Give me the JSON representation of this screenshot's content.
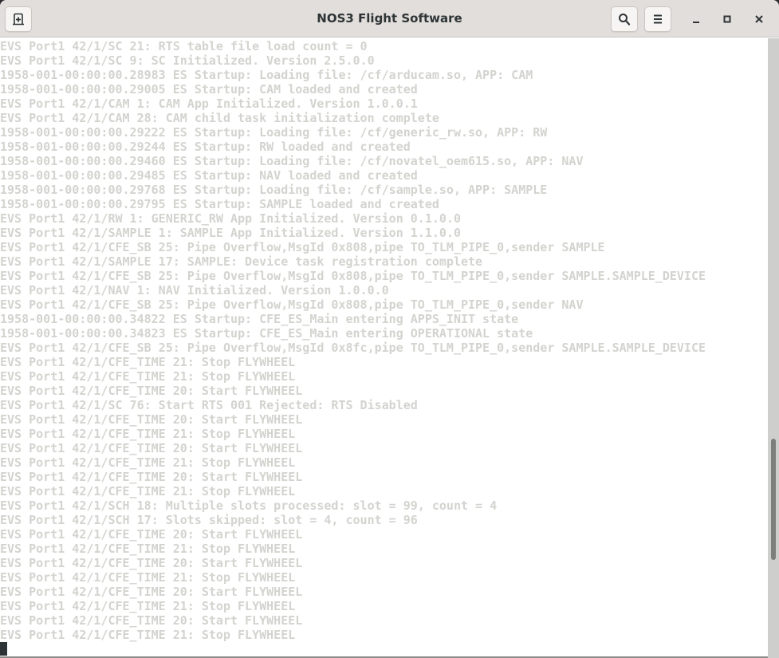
{
  "window": {
    "title": "NOS3 Flight Software"
  },
  "header": {
    "new_tab_icon": "new-tab-icon",
    "search_icon": "search-icon",
    "menu_icon": "hamburger-menu-icon",
    "minimize_icon": "minimize-icon",
    "maximize_icon": "maximize-icon",
    "close_icon": "close-icon"
  },
  "terminal": {
    "lines": [
      "EVS Port1 42/1/SC 21: RTS table file load count = 0",
      "EVS Port1 42/1/SC 9: SC Initialized. Version 2.5.0.0",
      "1958-001-00:00:00.28983 ES Startup: Loading file: /cf/arducam.so, APP: CAM",
      "1958-001-00:00:00.29005 ES Startup: CAM loaded and created",
      "EVS Port1 42/1/CAM 1: CAM App Initialized. Version 1.0.0.1",
      "EVS Port1 42/1/CAM 28: CAM child task initialization complete",
      "1958-001-00:00:00.29222 ES Startup: Loading file: /cf/generic_rw.so, APP: RW",
      "1958-001-00:00:00.29244 ES Startup: RW loaded and created",
      "1958-001-00:00:00.29460 ES Startup: Loading file: /cf/novatel_oem615.so, APP: NAV",
      "1958-001-00:00:00.29485 ES Startup: NAV loaded and created",
      "1958-001-00:00:00.29768 ES Startup: Loading file: /cf/sample.so, APP: SAMPLE",
      "1958-001-00:00:00.29795 ES Startup: SAMPLE loaded and created",
      "EVS Port1 42/1/RW 1: GENERIC_RW App Initialized. Version 0.1.0.0",
      "EVS Port1 42/1/SAMPLE 1: SAMPLE App Initialized. Version 1.1.0.0",
      "EVS Port1 42/1/CFE_SB 25: Pipe Overflow,MsgId 0x808,pipe TO_TLM_PIPE_0,sender SAMPLE",
      "EVS Port1 42/1/SAMPLE 17: SAMPLE: Device task registration complete",
      "EVS Port1 42/1/CFE_SB 25: Pipe Overflow,MsgId 0x808,pipe TO_TLM_PIPE_0,sender SAMPLE.SAMPLE_DEVICE",
      "EVS Port1 42/1/NAV 1: NAV Initialized. Version 1.0.0.0",
      "EVS Port1 42/1/CFE_SB 25: Pipe Overflow,MsgId 0x808,pipe TO_TLM_PIPE_0,sender NAV",
      "1958-001-00:00:00.34822 ES Startup: CFE_ES_Main entering APPS_INIT state",
      "1958-001-00:00:00.34823 ES Startup: CFE_ES_Main entering OPERATIONAL state",
      "EVS Port1 42/1/CFE_SB 25: Pipe Overflow,MsgId 0x8fc,pipe TO_TLM_PIPE_0,sender SAMPLE.SAMPLE_DEVICE",
      "EVS Port1 42/1/CFE_TIME 21: Stop FLYWHEEL",
      "EVS Port1 42/1/CFE_TIME 21: Stop FLYWHEEL",
      "EVS Port1 42/1/CFE_TIME 20: Start FLYWHEEL",
      "EVS Port1 42/1/SC 76: Start RTS 001 Rejected: RTS Disabled",
      "EVS Port1 42/1/CFE_TIME 20: Start FLYWHEEL",
      "EVS Port1 42/1/CFE_TIME 21: Stop FLYWHEEL",
      "EVS Port1 42/1/CFE_TIME 20: Start FLYWHEEL",
      "EVS Port1 42/1/CFE_TIME 21: Stop FLYWHEEL",
      "EVS Port1 42/1/CFE_TIME 20: Start FLYWHEEL",
      "EVS Port1 42/1/CFE_TIME 21: Stop FLYWHEEL",
      "EVS Port1 42/1/SCH 18: Multiple slots processed: slot = 99, count = 4",
      "EVS Port1 42/1/SCH 17: Slots skipped: slot = 4, count = 96",
      "EVS Port1 42/1/CFE_TIME 20: Start FLYWHEEL",
      "EVS Port1 42/1/CFE_TIME 21: Stop FLYWHEEL",
      "EVS Port1 42/1/CFE_TIME 20: Start FLYWHEEL",
      "EVS Port1 42/1/CFE_TIME 21: Stop FLYWHEEL",
      "EVS Port1 42/1/CFE_TIME 20: Start FLYWHEEL",
      "EVS Port1 42/1/CFE_TIME 21: Stop FLYWHEEL",
      "EVS Port1 42/1/CFE_TIME 20: Start FLYWHEEL",
      "EVS Port1 42/1/CFE_TIME 21: Stop FLYWHEEL"
    ],
    "text_color": "#d3d3cf",
    "background_color": "#ffffff"
  },
  "scrollbar": {
    "scroll_position_fraction": 0.8
  }
}
